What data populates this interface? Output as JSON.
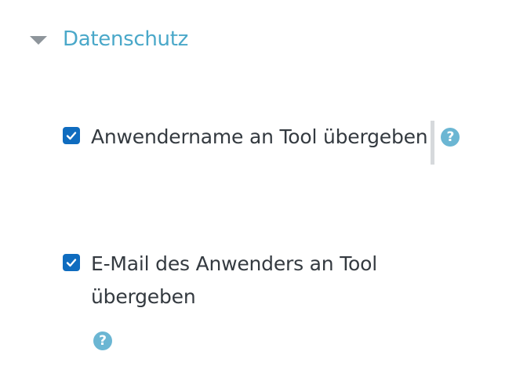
{
  "section": {
    "title": "Datenschutz"
  },
  "options": [
    {
      "label": "Anwendername an Tool übergeben",
      "checked": true
    },
    {
      "label": "E-Mail des Anwenders an Tool übergeben",
      "checked": true
    }
  ],
  "icons": {
    "collapse": "caret-down-icon",
    "help": "question-circle-icon",
    "check": "checkmark-icon"
  },
  "help_glyph": "?",
  "colors": {
    "accent": "#4aa8c9",
    "checkbox": "#0f6cbf",
    "help_icon": "#6bb6d3",
    "text": "#343a40"
  }
}
